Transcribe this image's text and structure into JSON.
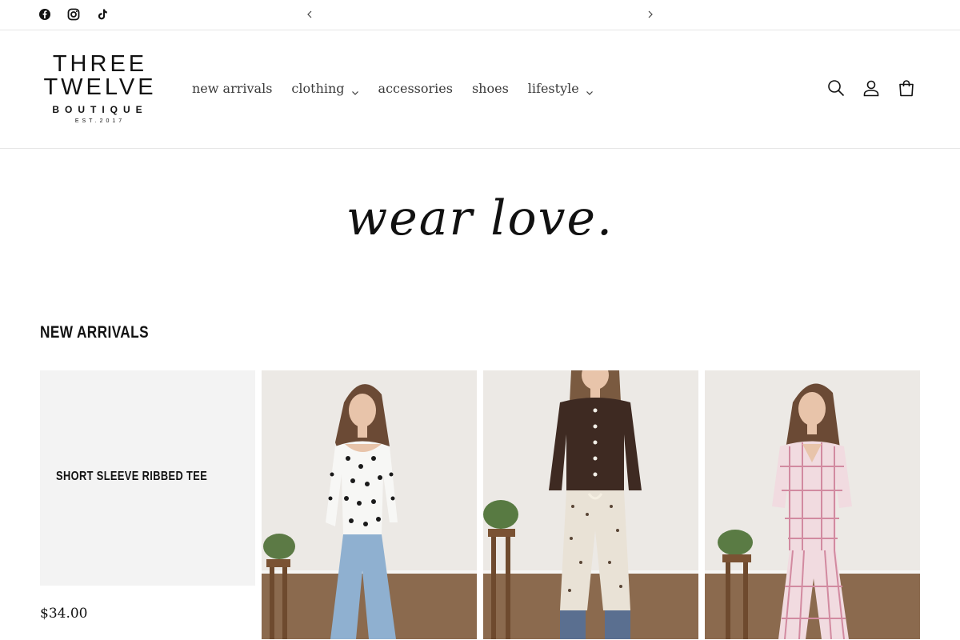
{
  "announcement": {
    "social": [
      "facebook-icon",
      "instagram-icon",
      "tiktok-icon"
    ],
    "prev_icon": "chevron-left-icon",
    "next_icon": "chevron-right-icon"
  },
  "header": {
    "logo": {
      "line1": "THREE",
      "line2": "TWELVE",
      "line3": "BOUTIQUE",
      "line4": "EST.2017"
    },
    "nav": [
      {
        "label": "new arrivals",
        "dropdown": false
      },
      {
        "label": "clothing",
        "dropdown": true
      },
      {
        "label": "accessories",
        "dropdown": false
      },
      {
        "label": "shoes",
        "dropdown": false
      },
      {
        "label": "lifestyle",
        "dropdown": true
      }
    ],
    "icons": [
      "search-icon",
      "account-icon",
      "cart-icon"
    ]
  },
  "banner": {
    "text": "wear love."
  },
  "section": {
    "title": "NEW ARRIVALS",
    "products": [
      {
        "name": "SHORT SLEEVE RIBBED TEE",
        "price": "$34.00"
      },
      {
        "image": "polka-dot-top-jeans-photo"
      },
      {
        "image": "brown-cardigan-floral-pants-photo"
      },
      {
        "image": "pink-plaid-set-photo"
      }
    ]
  },
  "colors": {
    "text": "#121212",
    "nav": "#3a3a3a",
    "card_bg": "#f3f3f3",
    "border": "#e6e6e6"
  }
}
